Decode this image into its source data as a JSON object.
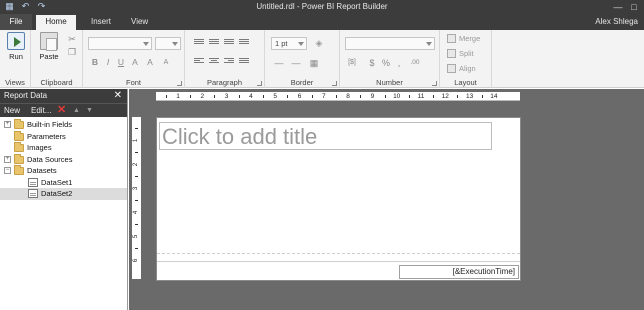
{
  "window": {
    "title": "Untitled.rdl - Power BI Report Builder",
    "icons": [
      "save-icon",
      "undo-icon",
      "redo-icon"
    ]
  },
  "tabs": {
    "file": "File",
    "home": "Home",
    "insert": "Insert",
    "view": "View"
  },
  "user": {
    "name": "Alex Shlega"
  },
  "ribbon": {
    "views": {
      "run_label": "Run",
      "group_label": "Views"
    },
    "clipboard": {
      "paste_label": "Paste",
      "group_label": "Clipboard"
    },
    "font": {
      "group_label": "Font",
      "bold": "B",
      "italic": "I",
      "underline": "U"
    },
    "paragraph": {
      "group_label": "Paragraph"
    },
    "border": {
      "width_value": "1 pt",
      "group_label": "Border"
    },
    "number": {
      "group_label": "Number",
      "percent": "%",
      "currency": "$",
      "decimal_label": ".00"
    },
    "layout": {
      "merge_label": "Merge",
      "split_label": "Split",
      "align_label": "Align",
      "group_label": "Layout"
    }
  },
  "report_data": {
    "header": "Report Data",
    "toolbar": {
      "new_label": "New",
      "edit_label": "Edit..."
    },
    "tree": [
      {
        "label": "Built-in Fields",
        "type": "folder",
        "expander": "+"
      },
      {
        "label": "Parameters",
        "type": "folder",
        "expander": ""
      },
      {
        "label": "Images",
        "type": "folder",
        "expander": ""
      },
      {
        "label": "Data Sources",
        "type": "folder",
        "expander": "+"
      },
      {
        "label": "Datasets",
        "type": "folder",
        "expander": "−"
      },
      {
        "label": "DataSet1",
        "type": "dataset",
        "expander": ""
      },
      {
        "label": "DataSet2",
        "type": "dataset",
        "expander": ""
      }
    ]
  },
  "ruler": {
    "horizontal": [
      "1",
      "2",
      "3",
      "4",
      "5",
      "6",
      "7",
      "8",
      "9",
      "10",
      "11",
      "12",
      "13",
      "14"
    ],
    "vertical": [
      "1",
      "2",
      "3",
      "4",
      "5",
      "6"
    ]
  },
  "canvas": {
    "title_placeholder": "Click to add title",
    "execution_time": "[&ExecutionTime]"
  }
}
